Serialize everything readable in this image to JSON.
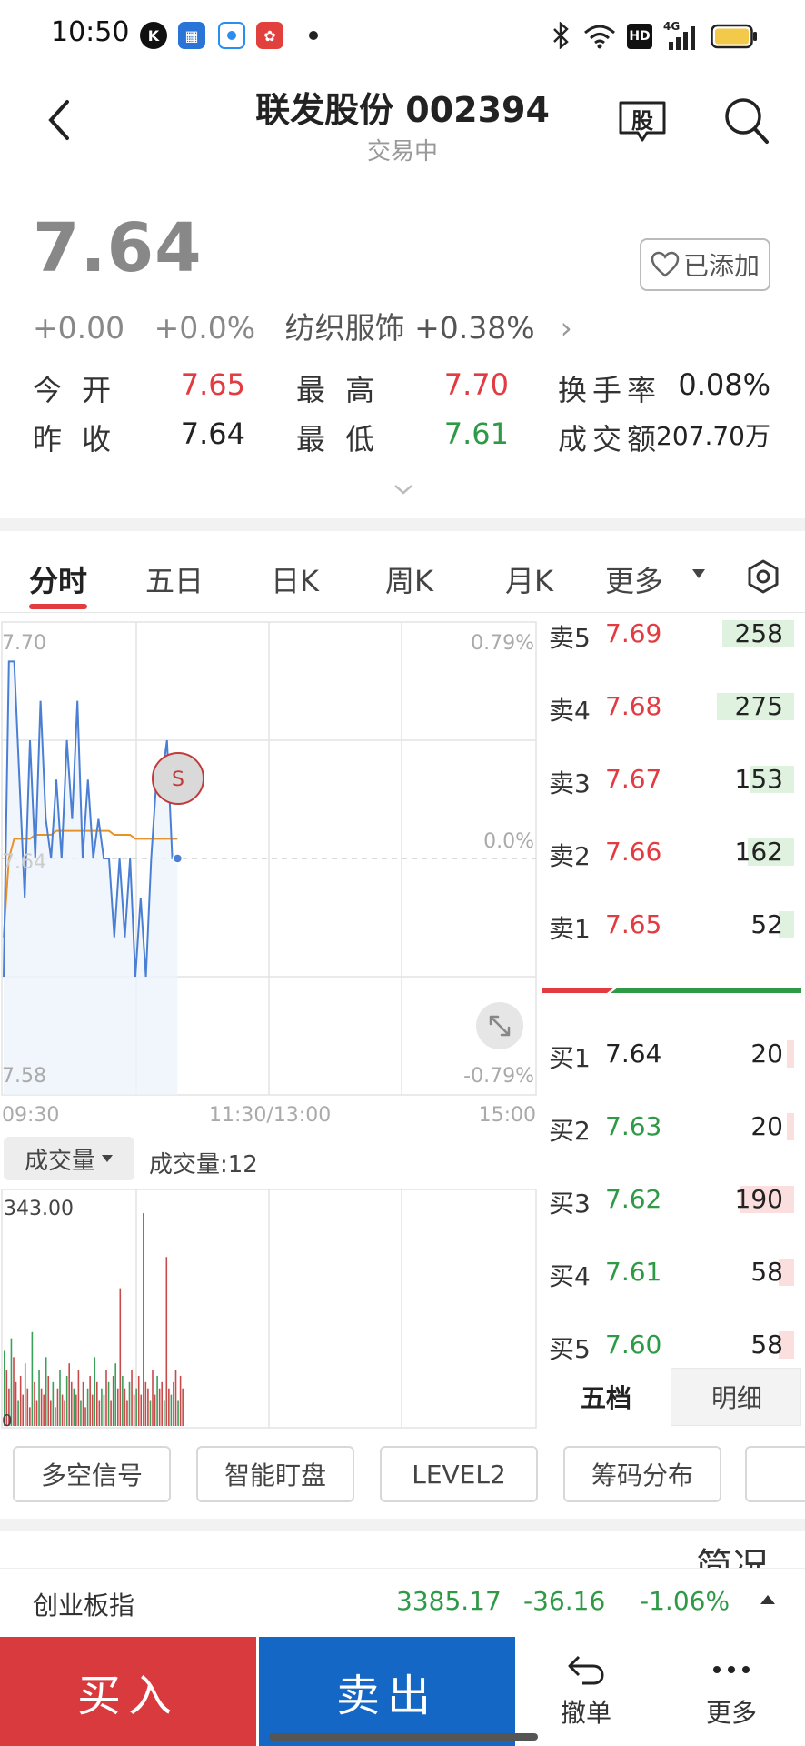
{
  "status_bar": {
    "time": "10:50",
    "network": "4G"
  },
  "header": {
    "title": "联发股份 002394",
    "subtitle": "交易中",
    "gu_label": "股"
  },
  "quote": {
    "price": "7.64",
    "change": "+0.00",
    "change_pct": "+0.0%",
    "industry": "纺织服饰 +0.38%",
    "added_label": "已添加",
    "stats": [
      {
        "label": "今 开",
        "value": "7.65",
        "color": "#e23b41"
      },
      {
        "label": "最 高",
        "value": "7.70",
        "color": "#e23b41"
      },
      {
        "label": "换手率",
        "value": "0.08%",
        "color": "#222222"
      },
      {
        "label": "昨 收",
        "value": "7.64",
        "color": "#222222"
      },
      {
        "label": "最 低",
        "value": "7.61",
        "color": "#2f9a46"
      },
      {
        "label": "成交额",
        "value": "207.70万",
        "color": "#222222"
      }
    ]
  },
  "tabs": [
    "分时",
    "五日",
    "日K",
    "周K",
    "月K",
    "更多"
  ],
  "chart": {
    "price_top": "7.70",
    "price_bottom": "7.58",
    "price_mid": "7.64",
    "pct_top": "0.79%",
    "pct_mid": "0.0%",
    "pct_bottom": "-0.79%",
    "time_start": "09:30",
    "time_mid": "11:30/13:00",
    "time_end": "15:00",
    "marker": "S",
    "vol_selector": "成交量",
    "vol_label": "成交量:12",
    "vol_max": "343.00",
    "zero": "0"
  },
  "chart_data": {
    "type": "line",
    "ylim": [
      7.58,
      7.7
    ],
    "series": [
      {
        "values": [
          7.61,
          7.69,
          7.69,
          7.66,
          7.63,
          7.67,
          7.64,
          7.68,
          7.65,
          7.64,
          7.66,
          7.64,
          7.67,
          7.65,
          7.68,
          7.64,
          7.66,
          7.64,
          7.65,
          7.64,
          7.64,
          7.62,
          7.64,
          7.62,
          7.64,
          7.61,
          7.63,
          7.61,
          7.64,
          7.66,
          7.66,
          7.67,
          7.64,
          7.64
        ]
      },
      {
        "values": [
          7.62,
          7.64,
          7.645,
          7.645,
          7.645,
          7.645,
          7.646,
          7.646,
          7.646,
          7.646,
          7.647,
          7.647,
          7.647,
          7.647,
          7.647,
          7.647,
          7.647,
          7.647,
          7.647,
          7.647,
          7.647,
          7.646,
          7.646,
          7.646,
          7.646,
          7.645,
          7.645,
          7.645,
          7.645,
          7.645,
          7.645,
          7.645,
          7.645,
          7.645
        ]
      }
    ],
    "volume": {
      "max": 343,
      "values": [
        120,
        90,
        60,
        140,
        110,
        70,
        40,
        80,
        50,
        100,
        60,
        30,
        150,
        70,
        40,
        90,
        60,
        50,
        110,
        80,
        40,
        70,
        30,
        60,
        90,
        50,
        40,
        80,
        100,
        70,
        60,
        50,
        90,
        40,
        70,
        30,
        60,
        80,
        50,
        110,
        70,
        40,
        60,
        50,
        90,
        70,
        40,
        80,
        100,
        60,
        220,
        80,
        60,
        40,
        70,
        90,
        50,
        60,
        80,
        50,
        340,
        70,
        60,
        40,
        90,
        50,
        80,
        60,
        70,
        40,
        270,
        60,
        50,
        70,
        90,
        40,
        80,
        60
      ]
    }
  },
  "order_book": {
    "sell": [
      {
        "label": "卖5",
        "price": "7.69",
        "vol": "258",
        "ratio": 0.28
      },
      {
        "label": "卖4",
        "price": "7.68",
        "vol": "275",
        "ratio": 0.3
      },
      {
        "label": "卖3",
        "price": "7.67",
        "vol": "153",
        "ratio": 0.17
      },
      {
        "label": "卖2",
        "price": "7.66",
        "vol": "162",
        "ratio": 0.18
      },
      {
        "label": "卖1",
        "price": "7.65",
        "vol": "52",
        "ratio": 0.06
      }
    ],
    "buy": [
      {
        "label": "买1",
        "price": "7.64",
        "vol": "20",
        "ratio": 0.02
      },
      {
        "label": "买2",
        "price": "7.63",
        "vol": "20",
        "ratio": 0.02
      },
      {
        "label": "买3",
        "price": "7.62",
        "vol": "190",
        "ratio": 0.21
      },
      {
        "label": "买4",
        "price": "7.61",
        "vol": "58",
        "ratio": 0.06
      },
      {
        "label": "买5",
        "price": "7.60",
        "vol": "58",
        "ratio": 0.06
      }
    ],
    "tab_wudang": "五档",
    "tab_mingxi": "明细"
  },
  "features": [
    "多空信号",
    "智能盯盘",
    "LEVEL2",
    "筹码分布"
  ],
  "section_peek": "简况",
  "index_ticker": {
    "name": "创业板指",
    "value": "3385.17",
    "change": "-36.16",
    "change_pct": "-1.06%"
  },
  "actions": {
    "buy": "买入",
    "sell": "卖出",
    "cancel": "撤单",
    "more": "更多"
  },
  "colors": {
    "up": "#e23b41",
    "down": "#2f9a46",
    "buy_bg": "#d93a3e",
    "sell_bg": "#1467c4",
    "price_line": "#4a7fd4",
    "avg_line": "#e8932a"
  }
}
